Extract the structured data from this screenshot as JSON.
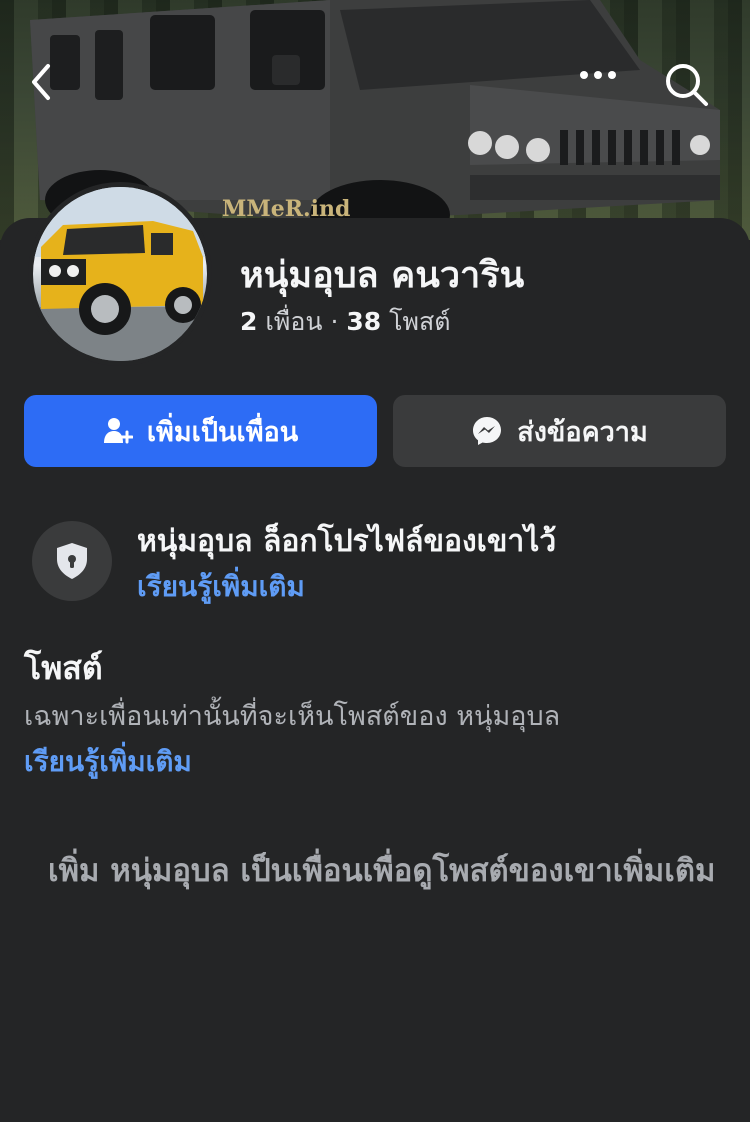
{
  "header": {
    "back_icon": "chevron-left-icon",
    "more_icon": "ellipsis-icon",
    "search_icon": "search-icon",
    "cover_watermark": "MMeR.ind"
  },
  "profile": {
    "name": "หนุ่มอุบล คนวาริน",
    "friends_count": "2",
    "friends_label": "เพื่อน",
    "separator": "·",
    "posts_count": "38",
    "posts_label": "โพสต์"
  },
  "actions": {
    "add_friend_label": "เพิ่มเป็นเพื่อน",
    "add_friend_icon": "add-friend-icon",
    "message_label": "ส่งข้อความ",
    "message_icon": "messenger-icon"
  },
  "locked": {
    "title": "หนุ่มอุบล ล็อกโปรไฟล์ของเขาไว้",
    "learn_more": "เรียนรู้เพิ่มเติม",
    "icon": "shield-lock-icon"
  },
  "posts": {
    "heading": "โพสต์",
    "description": "เฉพาะเพื่อนเท่านั้นที่จะเห็นโพสต์ของ หนุ่มอุบล",
    "learn_more": "เรียนรู้เพิ่มเติม",
    "add_friend_note": "เพิ่ม หนุ่มอุบล เป็นเพื่อนเพื่อดูโพสต์ของเขาเพิ่มเติม"
  },
  "colors": {
    "background": "#242526",
    "primary_button": "#2d6cf5",
    "secondary_button": "#3a3b3c",
    "link": "#5f9cf5"
  }
}
